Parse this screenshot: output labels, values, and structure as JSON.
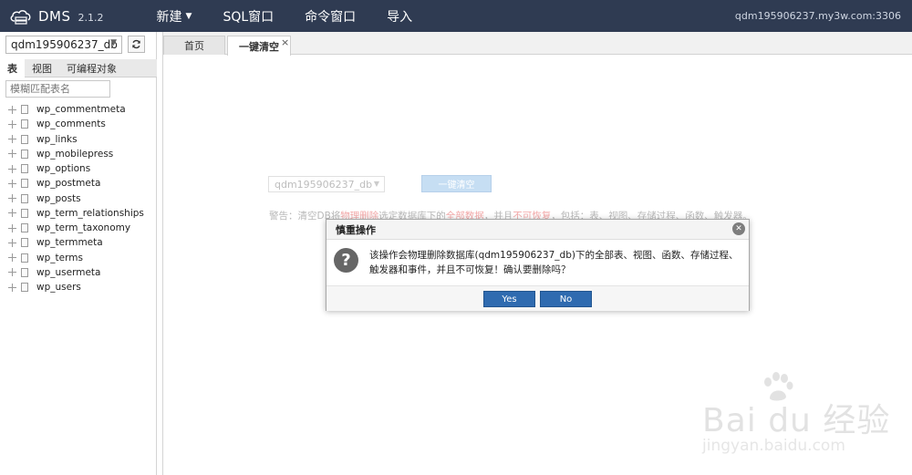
{
  "header": {
    "app_name": "DMS",
    "version": "2.1.2",
    "nav": [
      {
        "label": "新建",
        "has_caret": true
      },
      {
        "label": "SQL窗口"
      },
      {
        "label": "命令窗口"
      },
      {
        "label": "导入"
      }
    ],
    "server": "qdm195906237.my3w.com:3306"
  },
  "sidebar": {
    "db_select_value": "qdm195906237_db",
    "tabs": [
      "表",
      "视图",
      "可编程对象"
    ],
    "filter_placeholder": "模糊匹配表名",
    "tables": [
      "wp_commentmeta",
      "wp_comments",
      "wp_links",
      "wp_mobilepress",
      "wp_options",
      "wp_postmeta",
      "wp_posts",
      "wp_term_relationships",
      "wp_term_taxonomy",
      "wp_termmeta",
      "wp_terms",
      "wp_usermeta",
      "wp_users"
    ]
  },
  "tabs": {
    "home": "首页",
    "clear": "一键清空",
    "close_glyph": "×"
  },
  "clear_panel": {
    "db_value": "qdm195906237_db",
    "button": "一键清空",
    "warning_prefix": "警告：清空DB将",
    "warning_red1": "物理删除",
    "warning_mid": "选定数据库下的",
    "warning_red2": "全部数据",
    "warning_mid2": "，并且",
    "warning_red3": "不可恢复",
    "warning_suffix": "，包括：表、视图、存储过程、函数、触发器。"
  },
  "dialog": {
    "title": "慎重操作",
    "message": "该操作会物理删除数据库(qdm195906237_db)下的全部表、视图、函数、存储过程、触发器和事件，并且不可恢复！确认要删除吗？",
    "yes": "Yes",
    "no": "No",
    "icon_glyph": "?",
    "close_glyph": "✕"
  },
  "watermark": {
    "brand": "Bai du 经验",
    "url": "jingyan.baidu.com"
  }
}
